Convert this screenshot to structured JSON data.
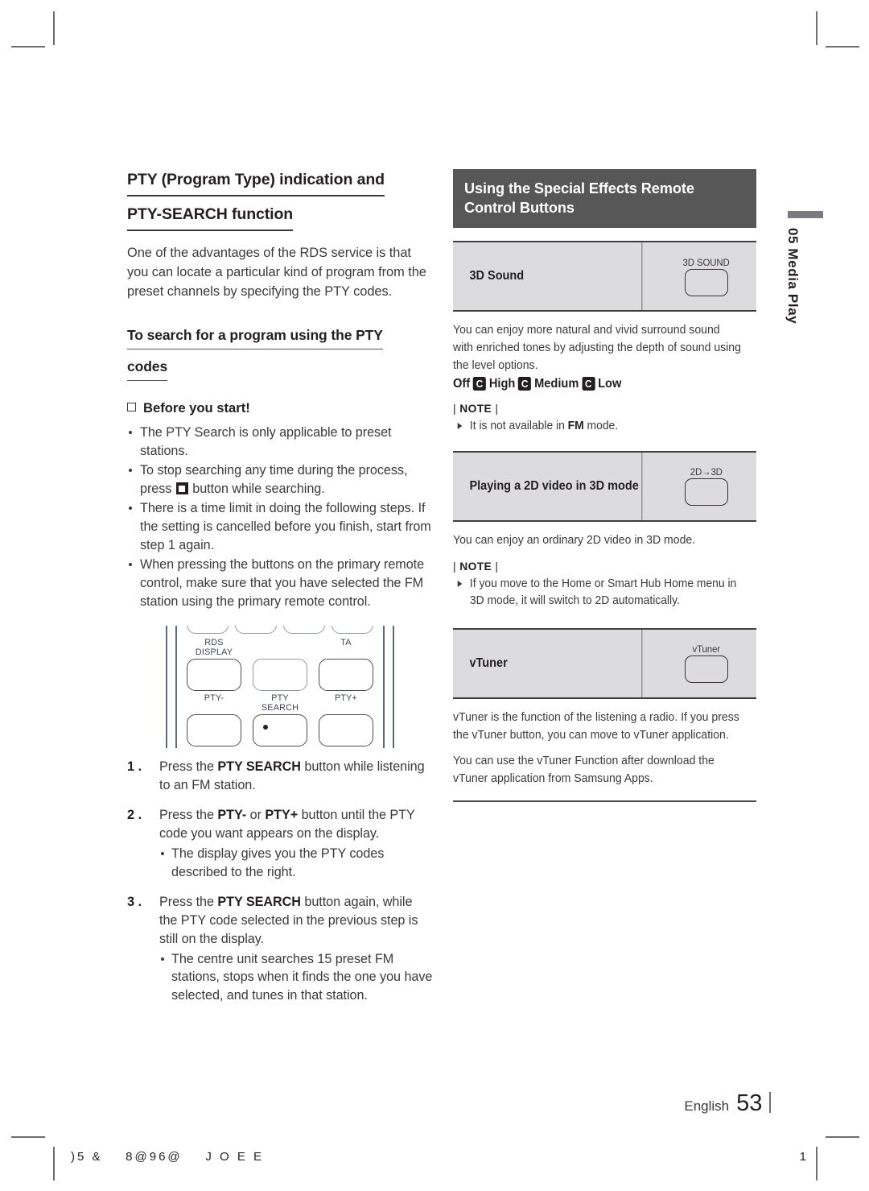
{
  "left": {
    "heading_line1": "PTY (Program Type) indication and",
    "heading_line2": "PTY-SEARCH function",
    "intro": "One of the advantages of the RDS service is that you can locate a particular kind of program from the preset channels by specifying the PTY codes.",
    "subheading_line1": "To search for a program using the PTY",
    "subheading_line2": "codes",
    "before_you_start": "Before you start!",
    "bullets": [
      "The PTY Search is only applicable to preset stations.",
      "To stop searching any time during the process, press  button while searching.",
      "There is a time limit in doing the following steps. If the setting is cancelled before you finish, start from step 1 again.",
      "When pressing the buttons on the primary remote control, make sure that you have selected the FM station using the primary remote control."
    ],
    "bullet2_pre": "To stop searching any time during the process, press",
    "bullet2_post": "button while searching.",
    "remote": {
      "row1_labels": [
        "RDS DISPLAY",
        "TA"
      ],
      "row2_labels": [
        "PTY-",
        "PTY SEARCH",
        "PTY+"
      ]
    },
    "steps": [
      {
        "num": "1 .",
        "text_pre": "Press the ",
        "bold": "PTY SEARCH",
        "text_post": " button while listening to an FM station.",
        "sub": []
      },
      {
        "num": "2 .",
        "text_pre": "Press the ",
        "bold": "PTY-",
        "mid": " or ",
        "bold2": "PTY+",
        "text_post": " button until the PTY code you want appears on the display.",
        "sub": [
          "The display gives you the PTY codes described to the right."
        ]
      },
      {
        "num": "3 .",
        "text_pre": "Press the ",
        "bold": "PTY SEARCH",
        "text_post": " button again, while the PTY code selected in the previous step is still on the display.",
        "sub": [
          "The centre unit searches 15 preset FM stations, stops when it finds the one you have selected, and tunes in that station."
        ]
      }
    ]
  },
  "right": {
    "band_line1": "Using the Special Effects Remote",
    "band_line2": "Control Buttons",
    "sections": [
      {
        "name": "3D Sound",
        "key_label": "3D SOUND",
        "body": "You can enjoy more natural and vivid surround sound with enriched tones by adjusting the depth of sound using the level options.",
        "options": [
          "Off",
          "High",
          "Medium",
          "Low"
        ],
        "option_badge": "C",
        "note_label": "NOTE",
        "note_items": [
          {
            "pre": "It is not available in ",
            "bold": "FM",
            "post": " mode."
          }
        ]
      },
      {
        "name": "Playing a 2D video in 3D mode",
        "key_label": "2D→3D",
        "body": "You can enjoy an ordinary 2D video in 3D mode.",
        "note_label": "NOTE",
        "note_items": [
          {
            "pre": "If you move to the Home or Smart Hub Home menu in 3D mode, it will switch to 2D automatically.",
            "bold": "",
            "post": ""
          }
        ]
      },
      {
        "name": "vTuner",
        "key_label": "vTuner",
        "body": "vTuner is the function of the listening a radio. If you press the vTuner button, you can move to vTuner application.",
        "body2": "You can use the vTuner Function after download the vTuner application from Samsung Apps."
      }
    ]
  },
  "side_tab": {
    "chapter": "05",
    "title": "Media Play",
    "combined": "05  Media Play"
  },
  "footer": {
    "language": "English",
    "page_number": "53",
    "print_code": ")5 &    8@96@    J O E E",
    "sheet_number": "1"
  },
  "colors": {
    "band_background": "#575757",
    "table_cell": "#dcdcde",
    "text": "#231f20",
    "body_text": "#3a3a3c",
    "tab_mark": "#7b7b7f"
  }
}
